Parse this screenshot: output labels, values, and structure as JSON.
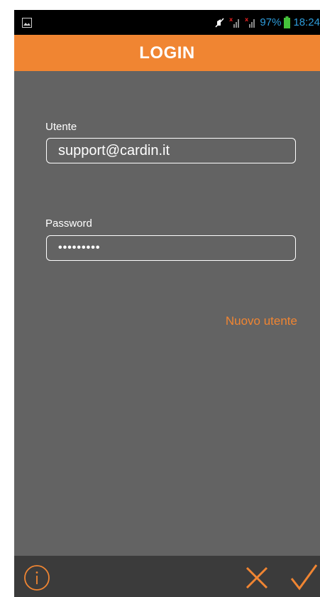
{
  "status_bar": {
    "battery_text": "97%",
    "time": "18:24",
    "icons": [
      "gallery-icon",
      "mute-icon",
      "signal-icon",
      "signal-icon",
      "battery-icon"
    ]
  },
  "header": {
    "title": "LOGIN"
  },
  "form": {
    "user_label": "Utente",
    "user_value": "support@cardin.it",
    "password_label": "Password",
    "password_value": "•••••••••",
    "new_user_link": "Nuovo utente"
  },
  "bottom_bar": {
    "icons": [
      "info-icon",
      "close-icon",
      "check-icon"
    ]
  },
  "colors": {
    "accent": "#f08532",
    "background": "#636363",
    "status_text": "#2d9cdb",
    "bottom_bar": "#3b3b3b"
  }
}
